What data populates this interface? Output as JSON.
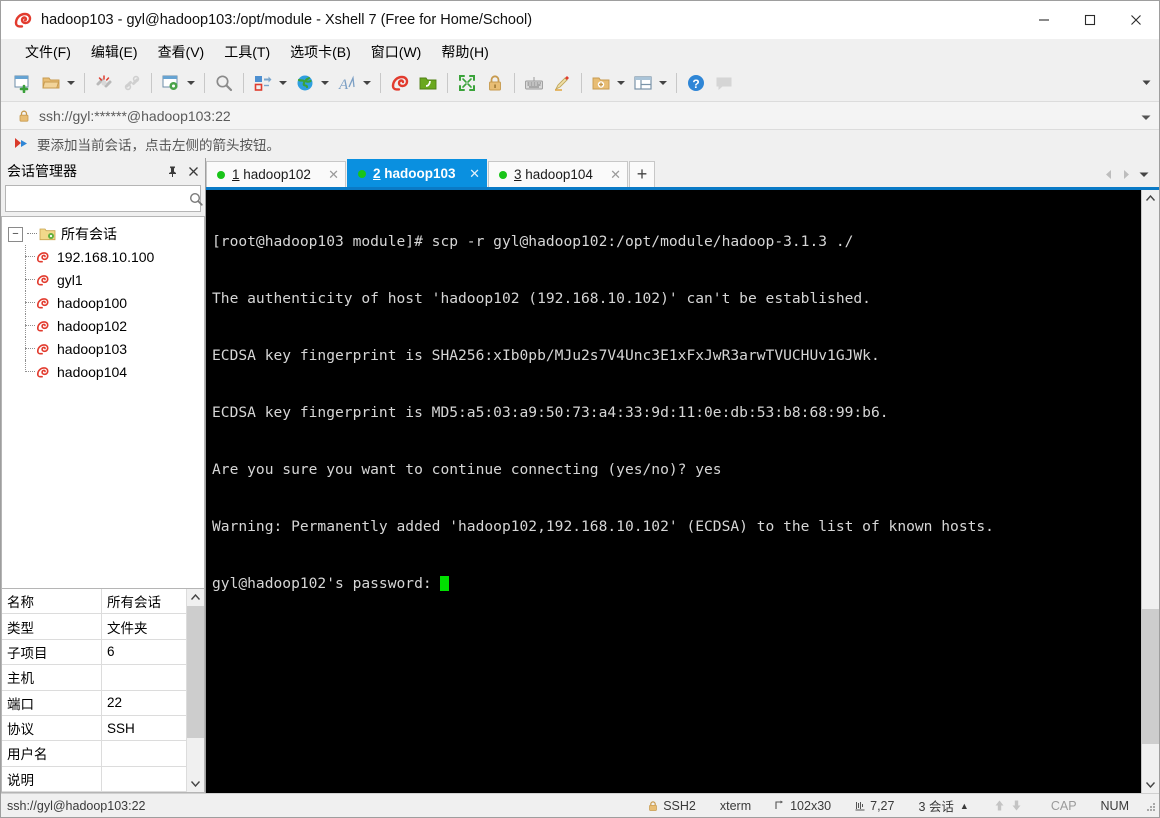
{
  "window": {
    "title": "hadoop103 - gyl@hadoop103:/opt/module - Xshell 7 (Free for Home/School)",
    "app_icon": "xshell-snail-icon",
    "minimize": "—",
    "maximize": "☐",
    "close": "✕"
  },
  "menu": {
    "items": [
      {
        "text": "文件(F)",
        "label": "文件",
        "accel": "F"
      },
      {
        "text": "编辑(E)",
        "label": "编辑",
        "accel": "E"
      },
      {
        "text": "查看(V)",
        "label": "查看",
        "accel": "V"
      },
      {
        "text": "工具(T)",
        "label": "工具",
        "accel": "T"
      },
      {
        "text": "选项卡(B)",
        "label": "选项卡",
        "accel": "B"
      },
      {
        "text": "窗口(W)",
        "label": "窗口",
        "accel": "W"
      },
      {
        "text": "帮助(H)",
        "label": "帮助",
        "accel": "H"
      }
    ]
  },
  "toolbar": {
    "icons": [
      "new-session-icon",
      "open-folder-icon",
      "reconnect-icon",
      "disconnect-icon",
      "session-properties-icon",
      "find-icon",
      "transfer-file-icon",
      "globe-icon",
      "font-icon",
      "xshell-icon",
      "xftp-icon",
      "fullscreen-icon",
      "lock-icon",
      "keyboard-icon",
      "highlight-icon",
      "add-folder-icon",
      "layout-icon",
      "help-icon",
      "chat-icon"
    ],
    "overflow": "toolbar-overflow-icon"
  },
  "address_bar": {
    "lock_icon": "lock-icon",
    "value": "ssh://gyl:******@hadoop103:22",
    "dropdown_icon": "chevron-down-icon"
  },
  "notification": {
    "icon": "red-arrow-icon",
    "text": "要添加当前会话，点击左侧的箭头按钮。"
  },
  "session_manager": {
    "title": "会话管理器",
    "pin_icon": "pin-icon",
    "close_icon": "close-icon",
    "search": {
      "value": "",
      "placeholder": "",
      "icon": "search-icon"
    },
    "tree": {
      "root": {
        "label": "所有会话",
        "icon": "folder-sessions-icon",
        "expander": "−"
      },
      "children": [
        {
          "label": "192.168.10.100",
          "icon": "session-icon"
        },
        {
          "label": "gyl1",
          "icon": "session-icon"
        },
        {
          "label": "hadoop100",
          "icon": "session-icon"
        },
        {
          "label": "hadoop102",
          "icon": "session-icon"
        },
        {
          "label": "hadoop103",
          "icon": "session-icon"
        },
        {
          "label": "hadoop104",
          "icon": "session-icon"
        }
      ]
    },
    "properties": [
      {
        "key": "名称",
        "value": "所有会话"
      },
      {
        "key": "类型",
        "value": "文件夹"
      },
      {
        "key": "子项目",
        "value": "6"
      },
      {
        "key": "主机",
        "value": ""
      },
      {
        "key": "端口",
        "value": "22"
      },
      {
        "key": "协议",
        "value": "SSH"
      },
      {
        "key": "用户名",
        "value": ""
      },
      {
        "key": "说明",
        "value": ""
      }
    ]
  },
  "tabs": {
    "items": [
      {
        "num": "1",
        "label": "hadoop102",
        "active": false,
        "close": "✕",
        "dot_color": "#19c419"
      },
      {
        "num": "2",
        "label": "hadoop103",
        "active": true,
        "close": "✕",
        "dot_color": "#19c419"
      },
      {
        "num": "3",
        "label": "hadoop104",
        "active": false,
        "close": "✕",
        "dot_color": "#19c419"
      }
    ],
    "add_label": "+",
    "nav_prev_icon": "chevron-left-icon",
    "nav_next_icon": "chevron-right-icon",
    "nav_menu_icon": "chevron-down-icon"
  },
  "terminal": {
    "lines": [
      "[root@hadoop103 module]# scp -r gyl@hadoop102:/opt/module/hadoop-3.1.3 ./",
      "The authenticity of host 'hadoop102 (192.168.10.102)' can't be established.",
      "ECDSA key fingerprint is SHA256:xIb0pb/MJu2s7V4Unc3E1xFxJwR3arwTVUCHUv1GJWk.",
      "ECDSA key fingerprint is MD5:a5:03:a9:50:73:a4:33:9d:11:0e:db:53:b8:68:99:b6.",
      "Are you sure you want to continue connecting (yes/no)? yes",
      "Warning: Permanently added 'hadoop102,192.168.10.102' (ECDSA) to the list of known hosts.",
      "gyl@hadoop102's password: "
    ],
    "cursor_color": "#00e000",
    "bg_color": "#000000",
    "fg_color": "#d6d6d6",
    "scroll_up_icon": "chevron-up-icon",
    "scroll_down_icon": "chevron-down-icon"
  },
  "statusbar": {
    "connection": "ssh://gyl@hadoop103:22",
    "security": "SSH2",
    "security_icon": "lock-icon",
    "term_type": "xterm",
    "size_icon": "size-icon",
    "size": "102x30",
    "cursor_icon": "cursor-pos-icon",
    "cursor_pos": "7,27",
    "sessions": "3 会话",
    "sessions_caret": "▲",
    "up_icon": "arrow-up-icon",
    "down_icon": "arrow-down-icon",
    "cap": "CAP",
    "num": "NUM",
    "grip": "resize-grip-icon"
  }
}
